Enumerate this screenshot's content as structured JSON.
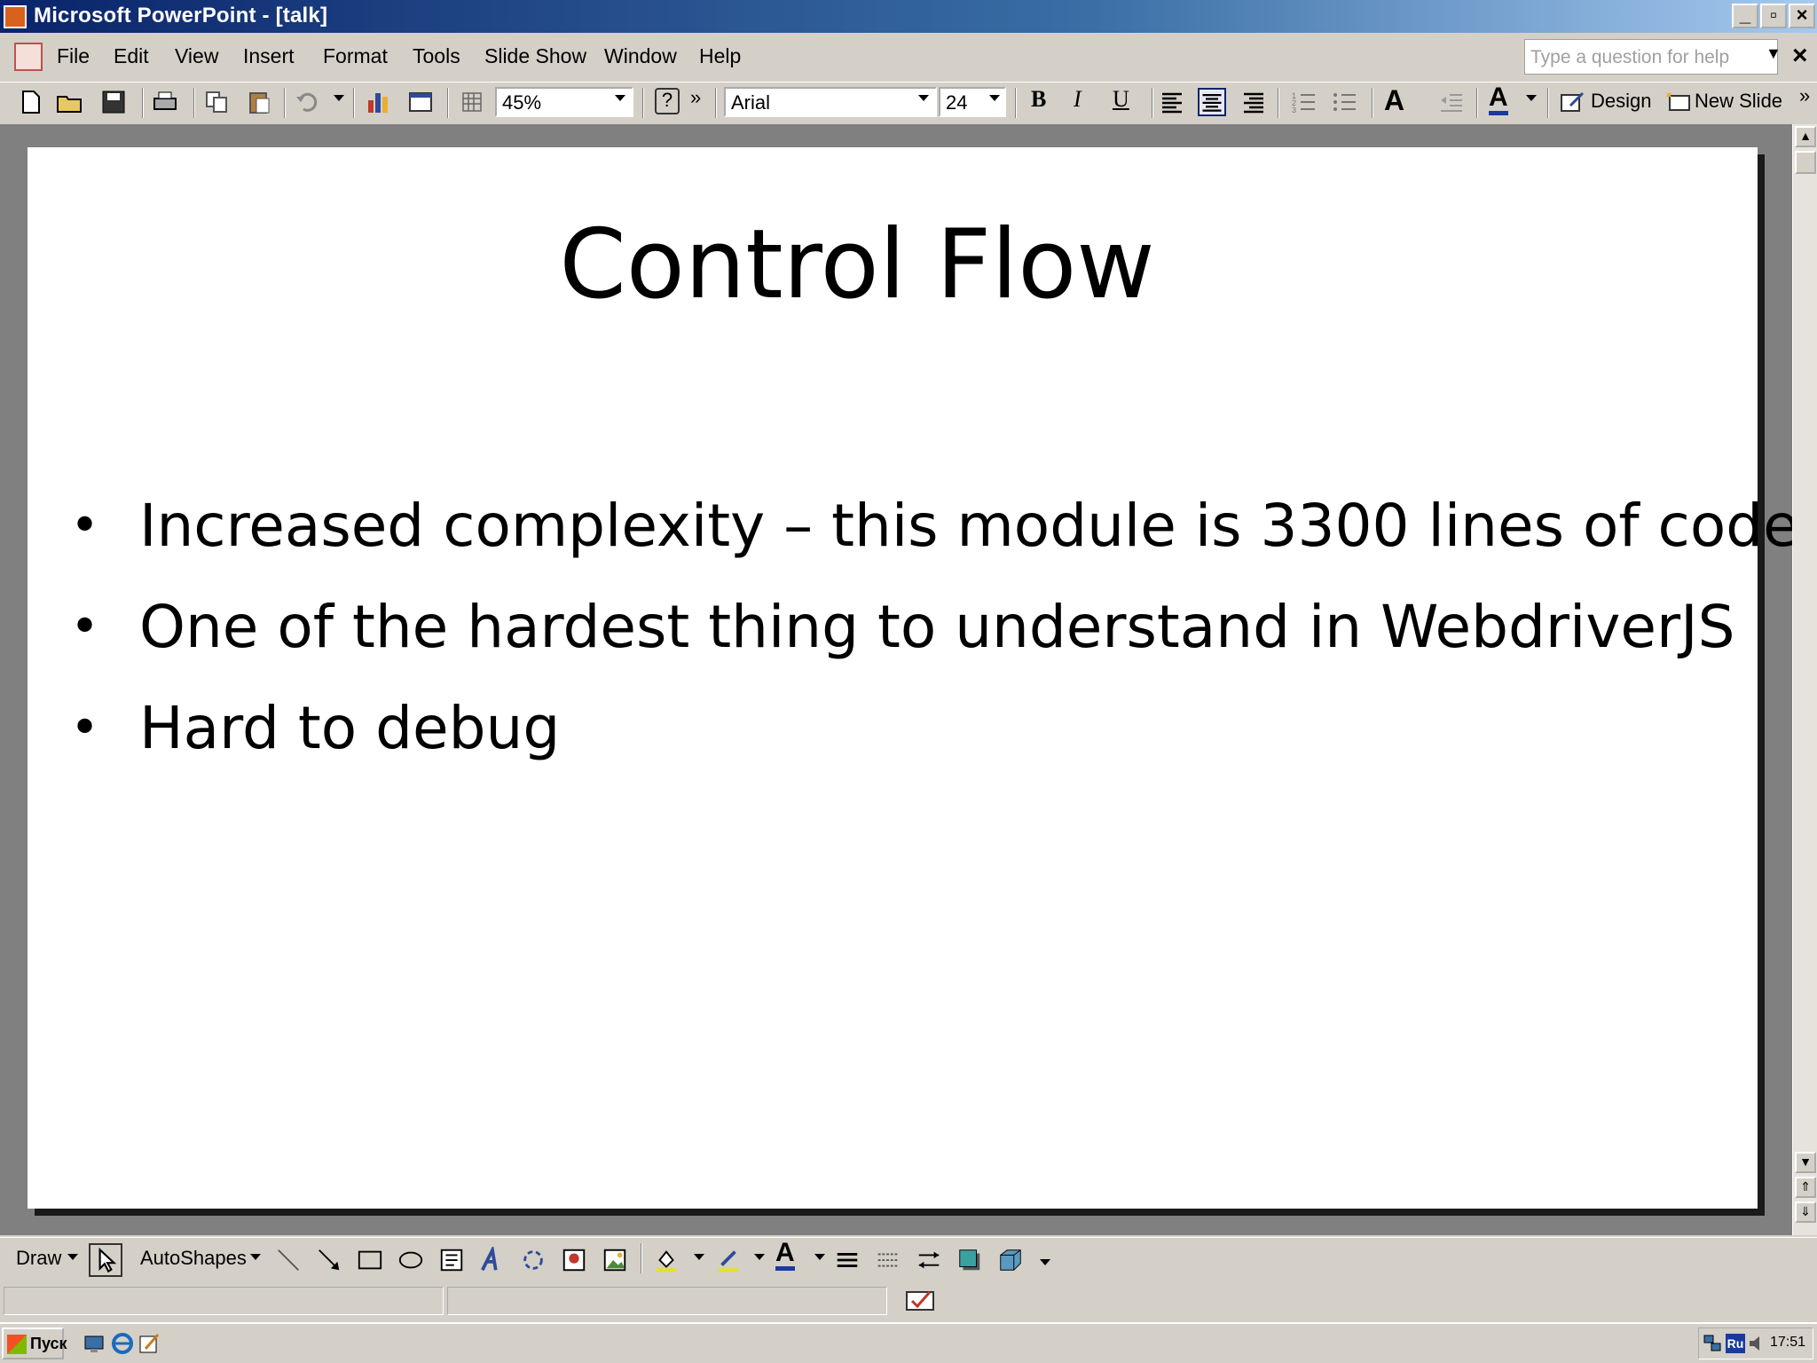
{
  "window": {
    "title": "Microsoft PowerPoint - [talk]",
    "min_symbol": "_",
    "max_symbol": "▫",
    "close_symbol": "×"
  },
  "menu": {
    "items": [
      "File",
      "Edit",
      "View",
      "Insert",
      "Format",
      "Tools",
      "Slide Show",
      "Window",
      "Help"
    ],
    "help_placeholder": "Type a question for help",
    "doc_close": "×"
  },
  "toolbar": {
    "zoom": "45%",
    "font_name": "Arial",
    "font_size": "24",
    "bold": "B",
    "italic": "I",
    "underline": "U",
    "grow_font": "A",
    "font_color": "A",
    "design_label": "Design",
    "new_slide_label": "New Slide",
    "more": "»",
    "help_q": "?"
  },
  "slide": {
    "title": "Control Flow",
    "bullet_char": "•",
    "bullets": [
      "Increased complexity – this module is 3300 lines of code",
      "One of the hardest thing to understand in WebdriverJS",
      "Hard to debug"
    ]
  },
  "drawing_toolbar": {
    "draw_label": "Draw",
    "autoshapes_label": "AutoShapes"
  },
  "taskbar": {
    "start_label": "Пуск",
    "language": "Ru",
    "clock": "17:51"
  },
  "colors": {
    "title_bar_start": "#0a246a",
    "title_bar_end": "#a6caf0",
    "chrome": "#d4d0c8",
    "workspace": "#808080",
    "slide_bg": "#ffffff"
  }
}
